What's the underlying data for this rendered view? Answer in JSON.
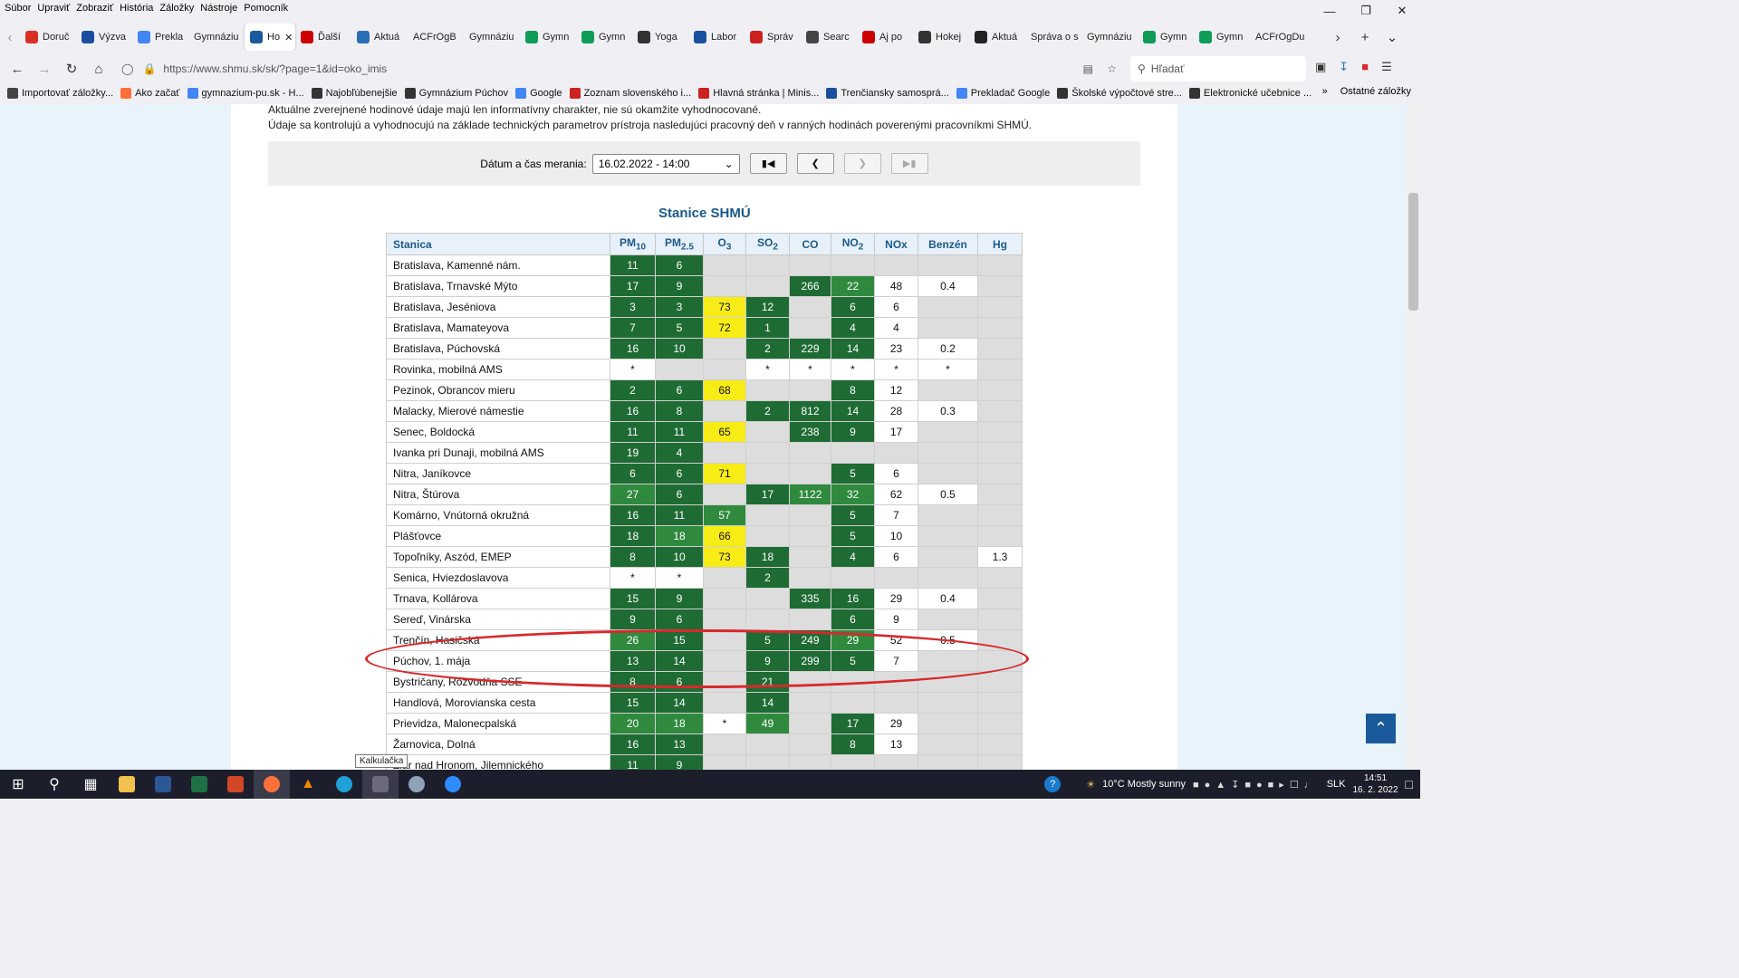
{
  "menu": [
    "Súbor",
    "Upraviť",
    "Zobraziť",
    "História",
    "Záložky",
    "Nástroje",
    "Pomocník"
  ],
  "tabs": [
    {
      "label": "Doruč",
      "color": "#d93025"
    },
    {
      "label": "Výzva",
      "color": "#1a4fa0"
    },
    {
      "label": "Prekla",
      "color": "#4285f4"
    },
    {
      "label": "Gymnáziu",
      "color": ""
    },
    {
      "label": "Ho",
      "color": "#1a5a9a",
      "active": true
    },
    {
      "label": "Ďalší",
      "color": "#cc0000"
    },
    {
      "label": "Aktuá",
      "color": "#2a6fb5"
    },
    {
      "label": "ACFrOgB",
      "color": ""
    },
    {
      "label": "Gymnáziu",
      "color": ""
    },
    {
      "label": "Gymn",
      "color": "#0f9d58"
    },
    {
      "label": "Gymn",
      "color": "#0f9d58"
    },
    {
      "label": "Yoga",
      "color": "#333"
    },
    {
      "label": "Labor",
      "color": "#1a4fa0"
    },
    {
      "label": "Správ",
      "color": "#cc2222"
    },
    {
      "label": "Searc",
      "color": "#444"
    },
    {
      "label": "Aj po",
      "color": "#cc0000"
    },
    {
      "label": "Hokej",
      "color": "#333"
    },
    {
      "label": "Aktuá",
      "color": "#222"
    },
    {
      "label": "Správa o s",
      "color": ""
    },
    {
      "label": "Gymnáziu",
      "color": ""
    },
    {
      "label": "Gymn",
      "color": "#0f9d58"
    },
    {
      "label": "Gymn",
      "color": "#0f9d58"
    },
    {
      "label": "ACFrOgDu",
      "color": ""
    }
  ],
  "url": "https://www.shmu.sk/sk/?page=1&id=oko_imis",
  "search_placeholder": "Hľadať",
  "bookmarks": [
    "Importovať záložky...",
    "Ako začať",
    "gymnazium-pu.sk - H...",
    "Najobľúbenejšie",
    "Gymnázium Púchov",
    "Google",
    "Zoznam slovenského i...",
    "Hlavná stránka | Minis...",
    "Trenčiansky samosprá...",
    "Prekladač Google",
    "Školské výpočtové stre...",
    "Elektronické učebnice ..."
  ],
  "other_bookmarks": "Ostatné záložky",
  "intro_lines": [
    "Aktuálne zverejnené hodinové údaje majú len informatívny charakter, nie sú okamžite vyhodnocované.",
    "Údaje sa kontrolujú a vyhodnocujú na základe technických parametrov prístroja nasledujúci pracovný deň v ranných hodinách poverenými pracovníkmi SHMÚ."
  ],
  "date_label": "Dátum a čas merania:",
  "date_value": "16.02.2022 - 14:00",
  "table_title": "Stanice SHMÚ",
  "headers": [
    "Stanica",
    "PM10",
    "PM2.5",
    "O3",
    "SO2",
    "CO",
    "NO2",
    "NOx",
    "Benzén",
    "Hg"
  ],
  "rows": [
    {
      "name": "Bratislava, Kamenné nám.",
      "v": [
        "11",
        "6",
        "",
        "",
        "",
        "",
        "",
        "",
        ""
      ],
      "c": [
        "g",
        "g",
        "e",
        "e",
        "e",
        "e",
        "e",
        "e",
        "e"
      ]
    },
    {
      "name": "Bratislava, Trnavské Mýto",
      "v": [
        "17",
        "9",
        "",
        "",
        "266",
        "22",
        "48",
        "0.4",
        ""
      ],
      "c": [
        "g",
        "g",
        "e",
        "e",
        "g",
        "lg",
        "w",
        "w",
        "e"
      ]
    },
    {
      "name": "Bratislava, Jeséniova",
      "v": [
        "3",
        "3",
        "73",
        "12",
        "",
        "6",
        "6",
        "",
        ""
      ],
      "c": [
        "g",
        "g",
        "y",
        "g",
        "e",
        "g",
        "w",
        "e",
        "e"
      ]
    },
    {
      "name": "Bratislava, Mamateyova",
      "v": [
        "7",
        "5",
        "72",
        "1",
        "",
        "4",
        "4",
        "",
        ""
      ],
      "c": [
        "g",
        "g",
        "y",
        "g",
        "e",
        "g",
        "w",
        "e",
        "e"
      ]
    },
    {
      "name": "Bratislava, Púchovská",
      "v": [
        "16",
        "10",
        "",
        "2",
        "229",
        "14",
        "23",
        "0.2",
        ""
      ],
      "c": [
        "g",
        "g",
        "e",
        "g",
        "g",
        "g",
        "w",
        "w",
        "e"
      ]
    },
    {
      "name": "Rovinka, mobilná AMS",
      "v": [
        "*",
        "",
        "",
        "*",
        "*",
        "*",
        "*",
        "*",
        ""
      ],
      "c": [
        "w",
        "e",
        "e",
        "w",
        "w",
        "w",
        "w",
        "w",
        "e"
      ]
    },
    {
      "name": "Pezinok, Obrancov mieru",
      "v": [
        "2",
        "6",
        "68",
        "",
        "",
        "8",
        "12",
        "",
        ""
      ],
      "c": [
        "g",
        "g",
        "y",
        "e",
        "e",
        "g",
        "w",
        "e",
        "e"
      ]
    },
    {
      "name": "Malacky, Mierové námestie",
      "v": [
        "16",
        "8",
        "",
        "2",
        "812",
        "14",
        "28",
        "0.3",
        ""
      ],
      "c": [
        "g",
        "g",
        "e",
        "g",
        "g",
        "g",
        "w",
        "w",
        "e"
      ]
    },
    {
      "name": "Senec, Boldocká",
      "v": [
        "11",
        "11",
        "65",
        "",
        "238",
        "9",
        "17",
        "",
        ""
      ],
      "c": [
        "g",
        "g",
        "y",
        "e",
        "g",
        "g",
        "w",
        "e",
        "e"
      ]
    },
    {
      "name": "Ivanka pri Dunaji, mobilná AMS",
      "v": [
        "19",
        "4",
        "",
        "",
        "",
        "",
        "",
        "",
        ""
      ],
      "c": [
        "g",
        "g",
        "e",
        "e",
        "e",
        "e",
        "e",
        "e",
        "e"
      ]
    },
    {
      "name": "Nitra, Janíkovce",
      "v": [
        "6",
        "6",
        "71",
        "",
        "",
        "5",
        "6",
        "",
        ""
      ],
      "c": [
        "g",
        "g",
        "y",
        "e",
        "e",
        "g",
        "w",
        "e",
        "e"
      ]
    },
    {
      "name": "Nitra, Štúrova",
      "v": [
        "27",
        "6",
        "",
        "17",
        "1122",
        "32",
        "62",
        "0.5",
        ""
      ],
      "c": [
        "lg",
        "g",
        "e",
        "g",
        "lg",
        "lg",
        "w",
        "w",
        "e"
      ]
    },
    {
      "name": "Komárno, Vnútorná okružná",
      "v": [
        "16",
        "11",
        "57",
        "",
        "",
        "5",
        "7",
        "",
        ""
      ],
      "c": [
        "g",
        "g",
        "lg",
        "e",
        "e",
        "g",
        "w",
        "e",
        "e"
      ]
    },
    {
      "name": "Plášťovce",
      "v": [
        "18",
        "18",
        "66",
        "",
        "",
        "5",
        "10",
        "",
        ""
      ],
      "c": [
        "g",
        "lg",
        "y",
        "e",
        "e",
        "g",
        "w",
        "e",
        "e"
      ]
    },
    {
      "name": "Topoľníky, Aszód, EMEP",
      "v": [
        "8",
        "10",
        "73",
        "18",
        "",
        "4",
        "6",
        "",
        "1.3"
      ],
      "c": [
        "g",
        "g",
        "y",
        "g",
        "e",
        "g",
        "w",
        "e",
        "w"
      ]
    },
    {
      "name": "Senica, Hviezdoslavova",
      "v": [
        "*",
        "*",
        "",
        "2",
        "",
        "",
        "",
        "",
        ""
      ],
      "c": [
        "w",
        "w",
        "e",
        "g",
        "e",
        "e",
        "e",
        "e",
        "e"
      ]
    },
    {
      "name": "Trnava, Kollárova",
      "v": [
        "15",
        "9",
        "",
        "",
        "335",
        "16",
        "29",
        "0.4",
        ""
      ],
      "c": [
        "g",
        "g",
        "e",
        "e",
        "g",
        "g",
        "w",
        "w",
        "e"
      ]
    },
    {
      "name": "Sereď, Vinárska",
      "v": [
        "9",
        "6",
        "",
        "",
        "",
        "6",
        "9",
        "",
        ""
      ],
      "c": [
        "g",
        "g",
        "e",
        "e",
        "e",
        "g",
        "w",
        "e",
        "e"
      ]
    },
    {
      "name": "Trenčín, Hasičská",
      "v": [
        "26",
        "15",
        "",
        "5",
        "249",
        "29",
        "52",
        "0.5",
        ""
      ],
      "c": [
        "lg",
        "g",
        "e",
        "g",
        "g",
        "lg",
        "w",
        "w",
        "e"
      ]
    },
    {
      "name": "Púchov, 1. mája",
      "v": [
        "13",
        "14",
        "",
        "9",
        "299",
        "5",
        "7",
        "",
        ""
      ],
      "c": [
        "g",
        "g",
        "e",
        "g",
        "g",
        "g",
        "w",
        "e",
        "e"
      ]
    },
    {
      "name": "Bystričany, Rozvodňa SSE",
      "v": [
        "8",
        "6",
        "",
        "21",
        "",
        "",
        "",
        "",
        ""
      ],
      "c": [
        "g",
        "g",
        "e",
        "g",
        "e",
        "e",
        "e",
        "e",
        "e"
      ]
    },
    {
      "name": "Handlová, Morovianska cesta",
      "v": [
        "15",
        "14",
        "",
        "14",
        "",
        "",
        "",
        "",
        ""
      ],
      "c": [
        "g",
        "g",
        "e",
        "g",
        "e",
        "e",
        "e",
        "e",
        "e"
      ]
    },
    {
      "name": "Prievidza, Malonecpalská",
      "v": [
        "20",
        "18",
        "*",
        "49",
        "",
        "17",
        "29",
        "",
        ""
      ],
      "c": [
        "lg",
        "lg",
        "w",
        "lg",
        "e",
        "g",
        "w",
        "e",
        "e"
      ]
    },
    {
      "name": "Žarnovica, Dolná",
      "v": [
        "16",
        "13",
        "",
        "",
        "",
        "8",
        "13",
        "",
        ""
      ],
      "c": [
        "g",
        "g",
        "e",
        "e",
        "e",
        "g",
        "w",
        "e",
        "e"
      ]
    },
    {
      "name": "Žiar nad Hronom, Jilemnického",
      "v": [
        "11",
        "9",
        "",
        "",
        "",
        "",
        "",
        "",
        ""
      ],
      "c": [
        "g",
        "g",
        "e",
        "e",
        "e",
        "e",
        "e",
        "e",
        "e"
      ]
    }
  ],
  "tooltip": "Kalkulačka",
  "taskbar": {
    "weather": "10°C  Mostly sunny",
    "lang": "SLK",
    "time": "14:51",
    "date": "16. 2. 2022"
  }
}
